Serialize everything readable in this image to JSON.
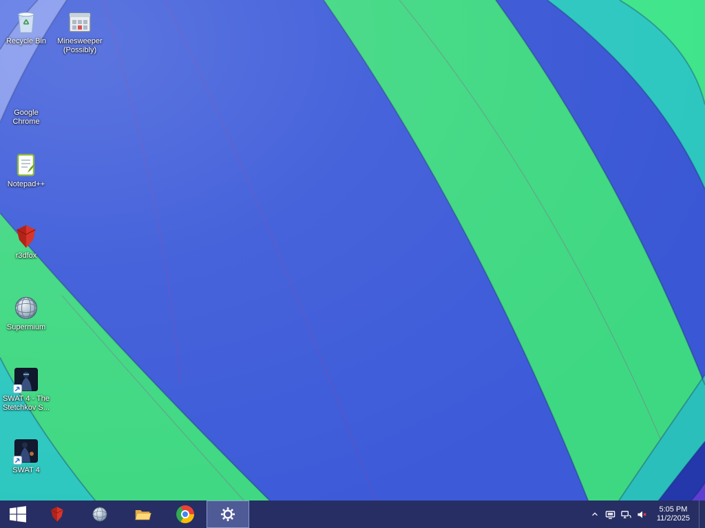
{
  "desktop": {
    "icons": [
      {
        "id": "recycle-bin",
        "label": "Recycle Bin",
        "label2": ""
      },
      {
        "id": "minesweeper",
        "label": "Minesweeper",
        "label2": "(Possibly)"
      },
      {
        "id": "google-chrome",
        "label": "Google",
        "label2": "Chrome"
      },
      {
        "id": "notepad-plus-plus",
        "label": "Notepad++",
        "label2": ""
      },
      {
        "id": "r3dfox",
        "label": "r3dfox",
        "label2": ""
      },
      {
        "id": "supermium",
        "label": "Supermium",
        "label2": ""
      },
      {
        "id": "swat4-stetchkov",
        "label": "SWAT 4 - The",
        "label2": "Stetchkov S..."
      },
      {
        "id": "swat4",
        "label": "SWAT 4",
        "label2": ""
      }
    ]
  },
  "taskbar": {
    "pinned": [
      "r3dfox",
      "supermium",
      "file-explorer",
      "chrome",
      "settings"
    ],
    "active_item": "settings",
    "tray": {
      "icons": [
        "show-hidden",
        "display",
        "network",
        "volume-muted"
      ],
      "time": "5:05 PM",
      "date": "11/2/2025"
    }
  },
  "wallpaper": {
    "palette": {
      "royal_blue": "#3D5BD9",
      "royal_blue_2": "#3A57D5",
      "medium_blue": "#5874E4",
      "periwinkle": "#8095EC",
      "green": "#3FD882",
      "bright_green": "#3FE58A",
      "teal": "#2CC7C0",
      "teal_dark": "#2BBFBB",
      "navy": "#2438AC",
      "purple": "#5C3FD2",
      "taskbar_bg": "#272E63"
    }
  }
}
